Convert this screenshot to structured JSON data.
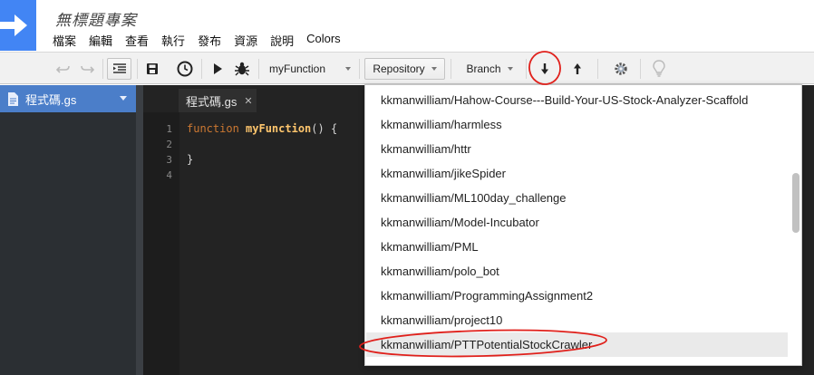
{
  "app": {
    "project_title": "無標題專案",
    "menu": [
      "檔案",
      "編輯",
      "查看",
      "執行",
      "發布",
      "資源",
      "說明",
      "Colors"
    ]
  },
  "toolbar": {
    "function_select": "myFunction",
    "repository_button": "Repository",
    "branch_button": "Branch",
    "icons": [
      "undo-icon",
      "redo-icon",
      "indent-icon",
      "save-icon",
      "clock-icon",
      "run-icon",
      "debug-icon",
      "pull-icon",
      "push-icon",
      "settings-icon",
      "lightbulb-icon"
    ]
  },
  "files": {
    "items": [
      {
        "label": "程式碼.gs"
      }
    ]
  },
  "editor": {
    "tab_label": "程式碼.gs",
    "tab_close": "✕",
    "line_numbers": [
      "1",
      "2",
      "3",
      "4"
    ],
    "code": {
      "keyword": "function",
      "function_name": "myFunction",
      "signature_rest": "() {",
      "closing": "}"
    }
  },
  "repository_dropdown": {
    "items": [
      "kkmanwilliam/Hahow-Course---Build-Your-US-Stock-Analyzer-Scaffold",
      "kkmanwilliam/harmless",
      "kkmanwilliam/httr",
      "kkmanwilliam/jikeSpider",
      "kkmanwilliam/ML100day_challenge",
      "kkmanwilliam/Model-Incubator",
      "kkmanwilliam/PML",
      "kkmanwilliam/polo_bot",
      "kkmanwilliam/ProgrammingAssignment2",
      "kkmanwilliam/project10",
      "kkmanwilliam/PTTPotentialStockCrawler"
    ],
    "highlighted_index": 10
  },
  "colors": {
    "brand_blue": "#4285f4",
    "annotation_red": "#e0201b",
    "selected_file_bg": "#4b7ec9"
  }
}
